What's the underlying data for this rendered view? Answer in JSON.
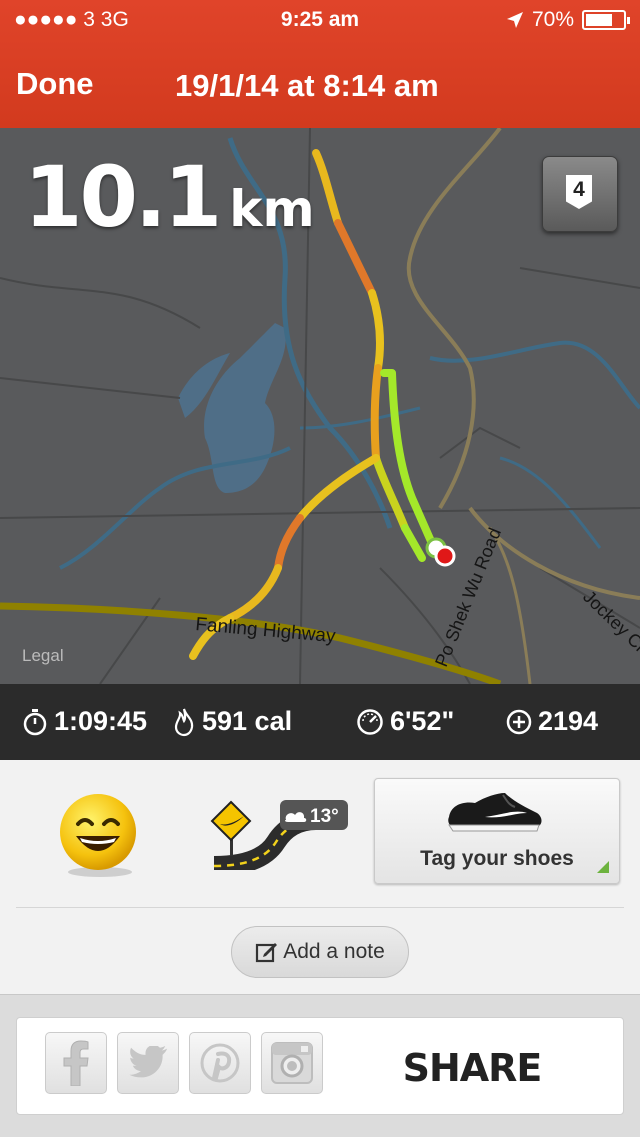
{
  "status": {
    "carrier": "●●●●● 3   3G",
    "time": "9:25 am",
    "battery": "70%"
  },
  "nav": {
    "done_label": "Done",
    "title": "19/1/14 at 8:14 am"
  },
  "map": {
    "distance_value": "10.1",
    "distance_unit": "km",
    "level": "4",
    "legal": "Legal",
    "labels": {
      "highway": "Fanling Highway",
      "road1": "Po Shek Wu Road",
      "road2": "Jockey Cl"
    }
  },
  "stats": {
    "duration": "1:09:45",
    "calories": "591 cal",
    "pace": "6'52\"",
    "fuel": "2194"
  },
  "tags": {
    "temperature": "13°",
    "shoes_label": "Tag your shoes"
  },
  "note": {
    "label": "Add a note"
  },
  "share": {
    "label": "SHARE"
  },
  "colors": {
    "header": "#d23a1e",
    "map_bg": "#595a5c",
    "stats_bg": "#2b2b2b",
    "route_fast": "#a4e82a",
    "route_slow": "#e84a1e"
  }
}
